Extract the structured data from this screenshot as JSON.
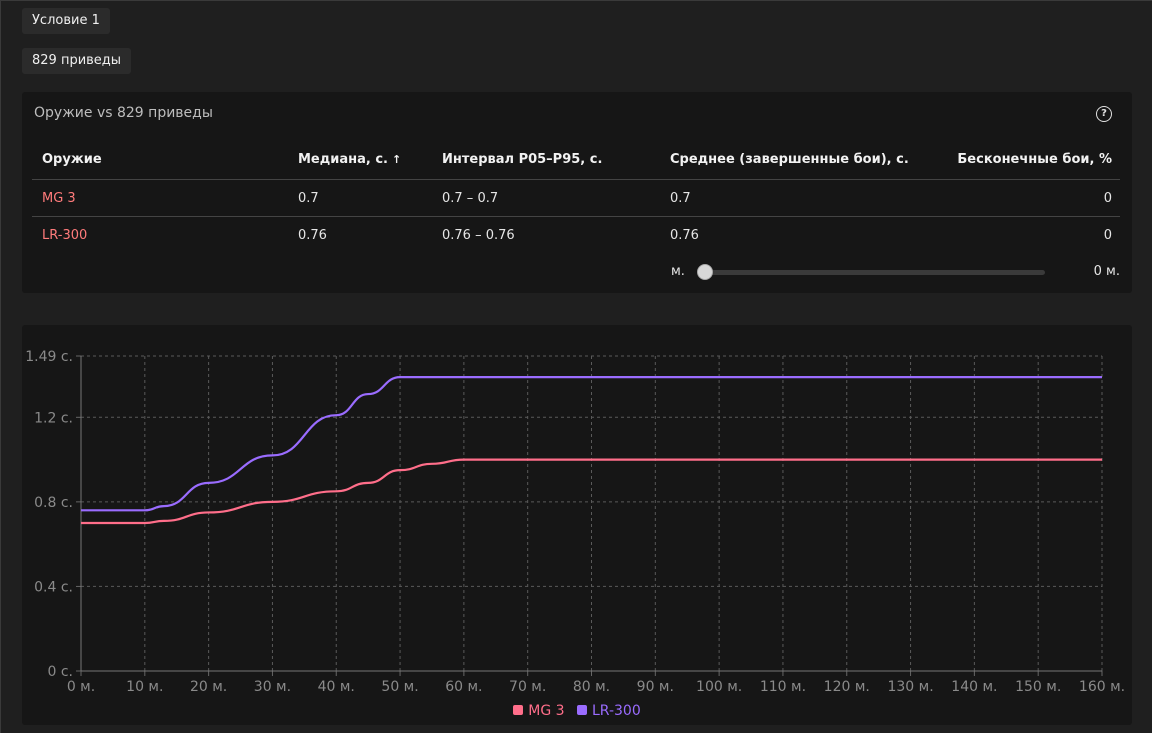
{
  "tags": {
    "condition": "Условие 1",
    "filter": "829 приведы"
  },
  "table": {
    "title": "Оружие vs 829 приведы",
    "help_icon": "question-circle-icon",
    "columns": [
      "Оружие",
      "Медиана, с.",
      "Интервал P05–P95, с.",
      "Среднее (завершенные бои), с.",
      "Бесконечные бои, %"
    ],
    "sort_arrow": "↑",
    "rows": [
      [
        "MG 3",
        "0.7",
        "0.7 – 0.7",
        "0.7",
        "0"
      ],
      [
        "LR-300",
        "0.76",
        "0.76 – 0.76",
        "0.76",
        "0"
      ]
    ],
    "slider": {
      "label": "м.",
      "value_label": "0 м.",
      "value": 0
    }
  },
  "colors": {
    "mg3": "#ff6e8a",
    "lr300": "#9a6cff",
    "weapon_text": "#ff7b7b"
  },
  "chart_data": {
    "type": "line",
    "x": [
      0,
      10,
      20,
      30,
      40,
      50,
      60,
      70,
      80,
      90,
      100,
      110,
      120,
      130,
      140,
      150,
      160
    ],
    "x_ticks": [
      "0 м.",
      "10 м.",
      "20 м.",
      "30 м.",
      "40 м.",
      "50 м.",
      "60 м.",
      "70 м.",
      "80 м.",
      "90 м.",
      "100 м.",
      "110 м.",
      "120 м.",
      "130 м.",
      "140 м.",
      "150 м.",
      "160 м."
    ],
    "y_ticks": [
      {
        "value": 0,
        "label": "0 с."
      },
      {
        "value": 0.4,
        "label": "0.4 с."
      },
      {
        "value": 0.8,
        "label": "0.8 с."
      },
      {
        "value": 1.2,
        "label": "1.2 с."
      },
      {
        "value": 1.49,
        "label": "1.49 с."
      }
    ],
    "xlim": [
      0,
      160
    ],
    "ylim": [
      0,
      1.49
    ],
    "grid": true,
    "legend_position": "bottom",
    "series": [
      {
        "name": "MG 3",
        "color": "#ff6e8a",
        "points": [
          [
            0,
            0.7
          ],
          [
            10,
            0.7
          ],
          [
            13,
            0.71
          ],
          [
            20,
            0.75
          ],
          [
            30,
            0.8
          ],
          [
            40,
            0.85
          ],
          [
            45,
            0.89
          ],
          [
            50,
            0.95
          ],
          [
            55,
            0.98
          ],
          [
            60,
            1.0
          ],
          [
            70,
            1.0
          ],
          [
            160,
            1.0
          ]
        ]
      },
      {
        "name": "LR-300",
        "color": "#9a6cff",
        "points": [
          [
            0,
            0.76
          ],
          [
            10,
            0.76
          ],
          [
            13,
            0.78
          ],
          [
            20,
            0.89
          ],
          [
            30,
            1.02
          ],
          [
            40,
            1.21
          ],
          [
            45,
            1.31
          ],
          [
            50,
            1.39
          ],
          [
            60,
            1.39
          ],
          [
            160,
            1.39
          ]
        ]
      }
    ]
  }
}
